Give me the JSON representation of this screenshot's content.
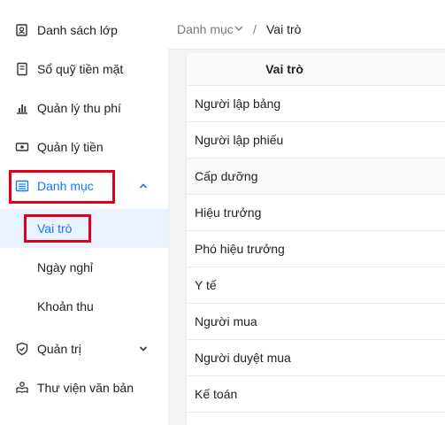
{
  "sidebar": {
    "items": [
      {
        "label": "Danh sách lớp",
        "icon": "book-user-icon"
      },
      {
        "label": "Sổ quỹ tiền mặt",
        "icon": "cash-book-icon"
      },
      {
        "label": "Quản lý thu phí",
        "icon": "bar-chart-icon"
      },
      {
        "label": "Quản lý tiền",
        "icon": "money-icon"
      },
      {
        "label": "Danh mục",
        "icon": "list-icon",
        "expanded": true
      },
      {
        "label": "Quản trị",
        "icon": "shield-icon",
        "expanded": false
      },
      {
        "label": "Thư viện văn bản",
        "icon": "library-icon"
      }
    ],
    "subitems": [
      {
        "label": "Vai trò",
        "active": true
      },
      {
        "label": "Ngày nghỉ"
      },
      {
        "label": "Khoản thu"
      }
    ]
  },
  "breadcrumb": {
    "parent": "Danh mục",
    "separator": "/",
    "current": "Vai trò"
  },
  "table": {
    "header": "Vai trò",
    "rows": [
      "Người lập bảng",
      "Người lập phiếu",
      "Cấp dưỡng",
      "Hiệu trưởng",
      "Phó hiệu trưởng",
      "Y tế",
      "Người mua",
      "Người duyệt mua",
      "Kế toán"
    ]
  },
  "colors": {
    "accent": "#1677ff",
    "highlight": "#e0001b",
    "active_bg": "#e8f3ff",
    "text": "#1f1f1f",
    "muted": "#7a7a7a"
  }
}
